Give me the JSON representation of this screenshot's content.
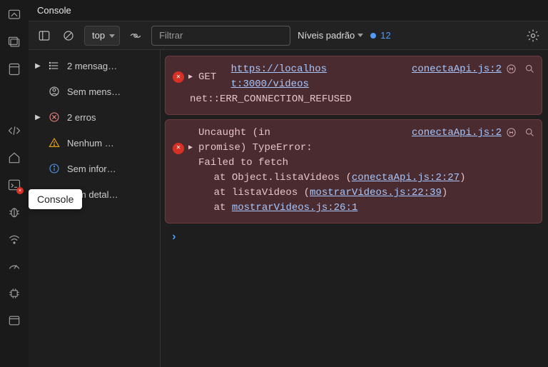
{
  "tabHeader": "Console",
  "toolbar": {
    "context": "top",
    "filterPlaceholder": "Filtrar",
    "logLevels": "Níveis padrão",
    "issuesCount": "12"
  },
  "sidebar": {
    "items": [
      {
        "label": "2 mensag…"
      },
      {
        "label": "Sem mens…"
      },
      {
        "label": "2 erros"
      },
      {
        "label": "Nenhum …"
      },
      {
        "label": "Sem infor…"
      },
      {
        "label": "Sem detal…"
      }
    ]
  },
  "tooltip": "Console",
  "logs": [
    {
      "method": "GET",
      "url": "https://localhost:3000/videos",
      "status": "net::ERR_CONNECTION_REFUSED",
      "sourceLink": "conectaApi.js:2"
    },
    {
      "head": "Uncaught (in promise) TypeError: Failed to fetch",
      "sourceLink": "conectaApi.js:2",
      "stack": [
        {
          "prefix": "at Object.listaVideos (",
          "link": "conectaApi.js:2:27",
          "suffix": ")"
        },
        {
          "prefix": "at listaVideos (",
          "link": "mostrarVideos.js:22:39",
          "suffix": ")"
        },
        {
          "prefix": "at ",
          "link": "mostrarVideos.js:26:1",
          "suffix": ""
        }
      ]
    }
  ]
}
